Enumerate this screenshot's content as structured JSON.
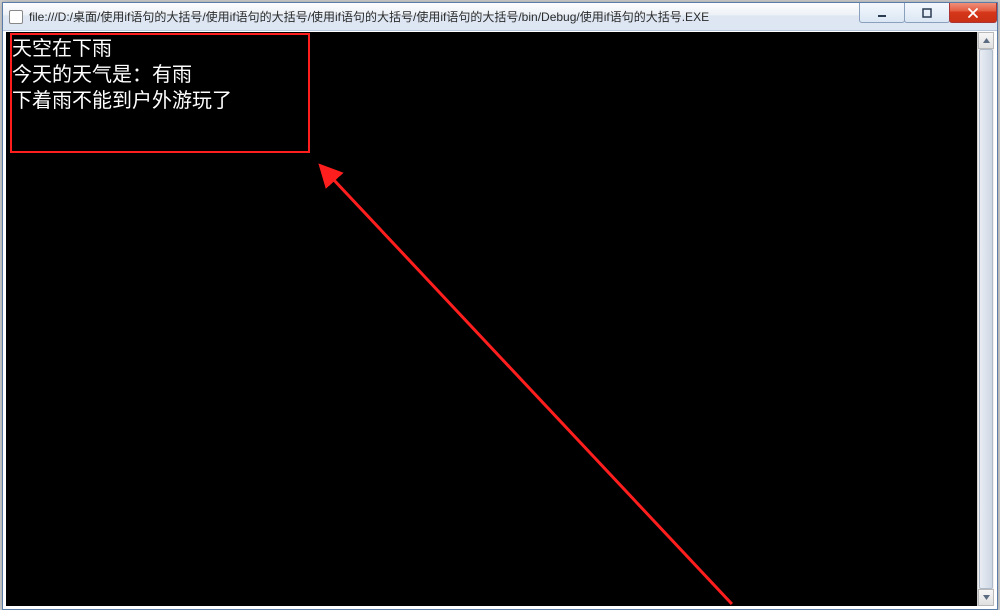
{
  "window": {
    "title": "file:///D:/桌面/使用if语句的大括号/使用if语句的大括号/使用if语句的大括号/使用if语句的大括号/bin/Debug/使用if语句的大括号.EXE"
  },
  "console": {
    "lines": [
      "天空在下雨",
      "今天的天气是：有雨",
      "下着雨不能到户外游玩了"
    ]
  },
  "annotation": {
    "highlight_color": "#ff1e1e"
  }
}
